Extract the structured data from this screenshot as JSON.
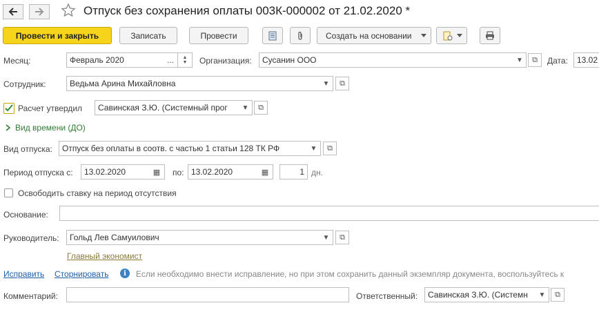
{
  "window": {
    "title": "Отпуск без сохранения оплаты 003К-000002 от 21.02.2020 *",
    "back_icon": "arrow-left-icon",
    "forward_icon": "arrow-right-icon",
    "favorite_icon": "star-icon"
  },
  "toolbar": {
    "post_close_label": "Провести и закрыть",
    "save_label": "Записать",
    "post_label": "Провести",
    "create_based_label": "Создать на основании",
    "icons": [
      "report-icon",
      "attachment-icon",
      "document-gear-icon",
      "print-icon"
    ]
  },
  "form": {
    "month_label": "Месяц:",
    "month_value": "Февраль 2020",
    "org_label": "Организация:",
    "org_value": "Сусанин ООО",
    "date_label": "Дата:",
    "date_value": "13.02",
    "employee_label": "Сотрудник:",
    "employee_value": "Ведьма Арина Михайловна",
    "approved_label": "Расчет утвердил",
    "approved_checked": true,
    "approved_value": "Савинская З.Ю. (Системный прог",
    "time_type_label": "Вид времени (ДО)",
    "leave_type_label": "Вид отпуска:",
    "leave_type_value": "Отпуск без оплаты в соотв. с частью 1 статьи 128 ТК РФ",
    "period_label": "Период отпуска с:",
    "period_from": "13.02.2020",
    "period_to_label": "по:",
    "period_to": "13.02.2020",
    "days_value": "1",
    "days_label": "дн.",
    "release_rate_label": "Освободить ставку на период отсутствия",
    "release_rate_checked": false,
    "basis_label": "Основание:",
    "basis_value": "",
    "manager_label": "Руководитель:",
    "manager_value": "Гольд Лев Самуилович",
    "manager_position": "Главный экономист",
    "fix_link": "Исправить",
    "storno_link": "Сторнировать",
    "info_text": "Если необходимо внести исправление, но при этом сохранить данный экземпляр документа, воспользуйтесь к",
    "comment_label": "Комментарий:",
    "comment_value": "",
    "responsible_label": "Ответственный:",
    "responsible_value": "Савинская З.Ю. (Системн"
  },
  "colors": {
    "primary_button": "#f7d41c",
    "link": "#1d5fa8",
    "section_link": "#2e7d32",
    "position_link": "#8a7a3c"
  }
}
